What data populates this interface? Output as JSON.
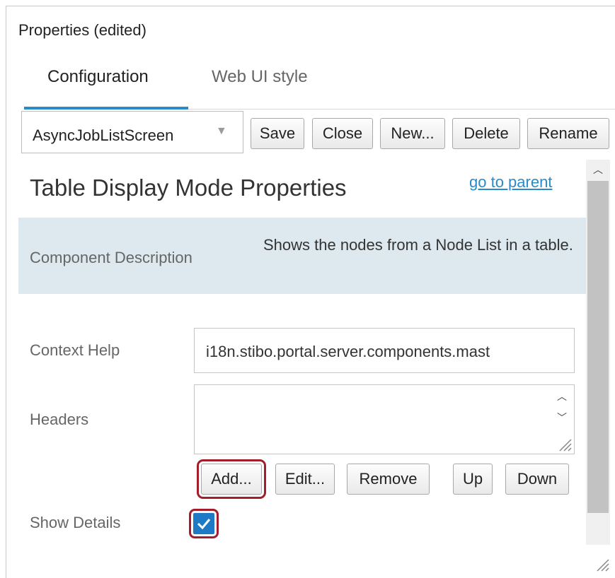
{
  "window": {
    "title": "Properties (edited)"
  },
  "tabs": [
    {
      "label": "Configuration",
      "active": true
    },
    {
      "label": "Web UI style",
      "active": false
    }
  ],
  "toolbar": {
    "screen_select": "AsyncJobListScreen",
    "save": "Save",
    "close": "Close",
    "new": "New...",
    "delete": "Delete",
    "rename": "Rename"
  },
  "section": {
    "title": "Table Display Mode Properties",
    "parent_link": "go to parent"
  },
  "description": {
    "label": "Component Description",
    "text": "Shows the nodes from a Node List in a table."
  },
  "fields": {
    "context_help": {
      "label": "Context Help",
      "value": "i18n.stibo.portal.server.components.mast"
    },
    "headers": {
      "label": "Headers",
      "value": "",
      "buttons": {
        "add": "Add...",
        "edit": "Edit...",
        "remove": "Remove",
        "up": "Up",
        "down": "Down"
      }
    },
    "show_details": {
      "label": "Show Details",
      "checked": true
    }
  },
  "colors": {
    "accent": "#2a8bc8",
    "highlight": "#a31d2a",
    "checkbox": "#1e7ac4",
    "description_band": "#dde9ee"
  },
  "icons": {
    "select_caret": "chevron-down-icon",
    "scroll_up": "scroll-up-arrow-icon",
    "checkbox_check": "checkmark-icon",
    "resize": "resize-grip-icon"
  }
}
